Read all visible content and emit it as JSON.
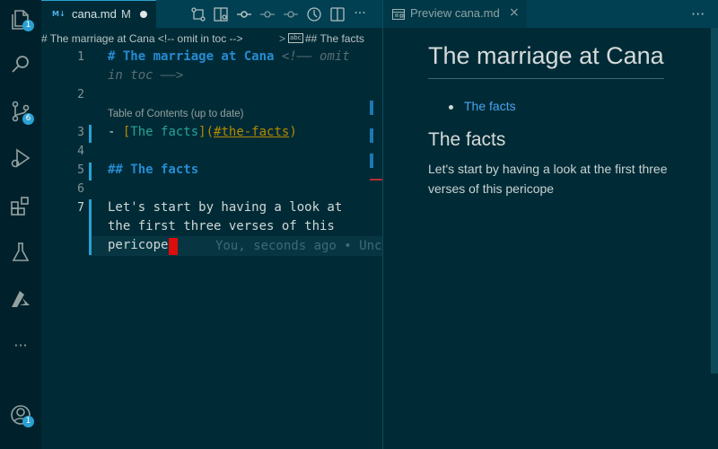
{
  "activity_bar": {
    "explorer_badge": "1",
    "source_control_badge": "6",
    "accounts_badge": "1"
  },
  "editor": {
    "tab": {
      "icon_label": "M↓",
      "title": "cana.md",
      "modified_marker": "M"
    },
    "breadcrumb": {
      "item1": "# The marriage at Cana <!-- omit in toc -->",
      "separator": ">",
      "icon_label": "abc",
      "item2": "## The facts"
    },
    "line_numbers": [
      "1",
      "2",
      "3",
      "4",
      "5",
      "6",
      "7"
    ],
    "lines": {
      "l1_heading": "# The marriage at Cana",
      "l1_comment_a": " <!—— omit",
      "l1_comment_b": "in toc ——>",
      "toc_codelens": "Table of Contents (up to date)",
      "l3_dash": "- ",
      "l3_open": "[",
      "l3_text": "The facts",
      "l3_close": "]",
      "l3_paren_open": "(",
      "l3_url": "#the-facts",
      "l3_paren_close": ")",
      "l5_heading": "## The facts",
      "l7_a": "Let's start by having a look at",
      "l7_b": "the first three verses of this",
      "l7_c": "pericope"
    },
    "blame": "You, seconds ago • Unc"
  },
  "preview": {
    "tab_title": "Preview cana.md",
    "close_glyph": "×",
    "h1": "The marriage at Cana",
    "toc_link": "The facts",
    "h2": "The facts",
    "paragraph": "Let's start by having a look at the first three verses of this pericope"
  },
  "more_glyph": "···",
  "colors": {
    "background": "#002b36",
    "accent": "#2aa1d3",
    "heading": "#268bd2",
    "link": "#2aa198",
    "url": "#b58900",
    "cursor": "#dc0d0d"
  }
}
